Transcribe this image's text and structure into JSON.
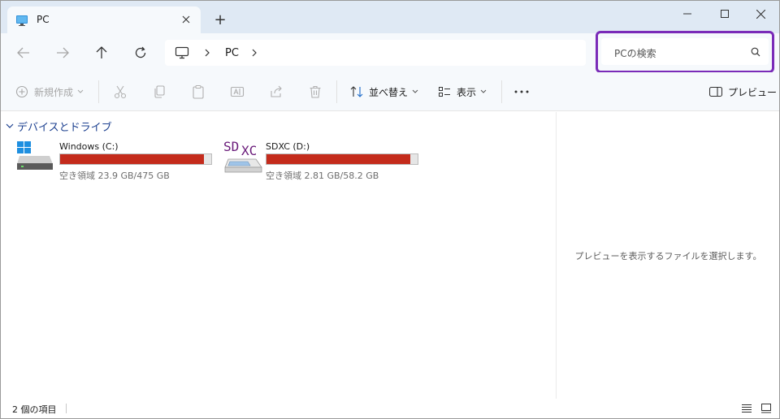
{
  "window": {
    "tab_title": "PC",
    "new_tab_symbol": "+",
    "controls": [
      "minimize-icon",
      "maximize-icon",
      "close-icon"
    ]
  },
  "nav": {
    "back": "arrow-left-icon",
    "forward": "arrow-right-icon",
    "up": "arrow-up-icon",
    "refresh": "refresh-icon",
    "breadcrumb": [
      "PC"
    ],
    "search_placeholder": "PCの検索"
  },
  "toolbar": {
    "new_label": "新規作成",
    "sort_label": "並べ替え",
    "view_label": "表示",
    "more_label": "…",
    "preview_label": "プレビュー"
  },
  "content": {
    "group_title": "デバイスとドライブ",
    "drives": [
      {
        "name": "Windows (C:)",
        "free_text": "空き領域 23.9 GB/475 GB",
        "used_fraction": 0.95,
        "icon": "windows-drive-icon"
      },
      {
        "name": "SDXC (D:)",
        "free_text": "空き領域 2.81 GB/58.2 GB",
        "used_fraction": 0.95,
        "icon": "sd-card-drive-icon",
        "icon_text_a": "SD",
        "icon_text_b": "XC"
      }
    ]
  },
  "preview": {
    "message": "プレビューを表示するファイルを選択します。"
  },
  "status": {
    "item_count": "2 個の項目"
  },
  "colors": {
    "accent": "#1b3f8f",
    "bar_fill": "#c42b1c",
    "search_highlight": "#7a2bb8",
    "sd_text": "#6a1b7a"
  }
}
